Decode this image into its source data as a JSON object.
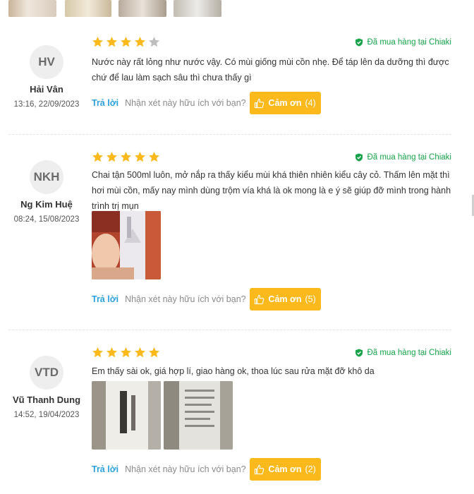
{
  "verified_label": "Đã mua hàng tại Chiaki",
  "reply_label": "Trả lời",
  "helpful_question": "Nhận xét này hữu ích với bạn?",
  "thanks_label": "Cảm ơn",
  "colors": {
    "star": "#fbb91c",
    "star_empty": "#bdbdbd",
    "verified": "#18a34a",
    "reply": "#2aa0df",
    "thanks_bg": "#fbb91c"
  },
  "reviews": [
    {
      "initials": "HV",
      "name": "Hải Vân",
      "date": "13:16, 22/09/2023",
      "rating": 4,
      "text": "Nước này rất lỏng như nước vậy. Có mùi giống mùi cồn nhẹ. Để táp lên da dưỡng thì được chứ để lau làm sạch sâu thì chưa thấy gì",
      "thanks_count": "(4)"
    },
    {
      "initials": "NKH",
      "name": "Ng Kim Huệ",
      "date": "08:24, 15/08/2023",
      "rating": 5,
      "text": "Chai tận 500ml luôn, mở nắp ra thấy kiểu mùi khá thiên nhiên kiểu cây cỏ. Thấm lên mặt thì hơi mùi cồn, mấy nay mình dùng trộm vía khá là ok mong là e ý sẽ giúp đỡ mình trong hành trình trị mụn",
      "thanks_count": "(5)"
    },
    {
      "initials": "VTD",
      "name": "Vũ Thanh Dung",
      "date": "14:52, 19/04/2023",
      "rating": 5,
      "text": "Em thấy sài ok, giá hợp lí, giao hàng ok, thoa lúc sau rửa mặt đỡ khô da",
      "thanks_count": "(2)"
    }
  ]
}
